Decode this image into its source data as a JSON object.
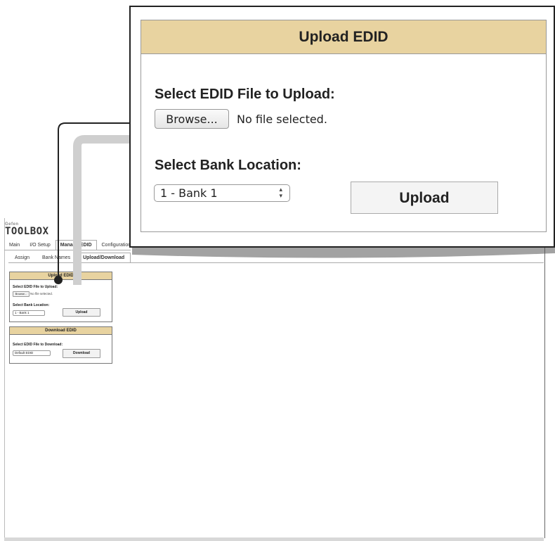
{
  "app": {
    "logo_small": "Gefen",
    "logo_big": "TOOLBOX"
  },
  "main_tabs": [
    {
      "label": "Main"
    },
    {
      "label": "I/O Setup"
    },
    {
      "label": "Manage EDID"
    },
    {
      "label": "Configuration"
    }
  ],
  "sub_tabs": [
    {
      "label": "Assign"
    },
    {
      "label": "Bank Names"
    },
    {
      "label": "Upload/Download"
    }
  ],
  "upload_panel": {
    "title": "Upload EDID",
    "file_label": "Select EDID File to Upload:",
    "browse_label": "Browse...",
    "file_status": "No file selected.",
    "bank_label": "Select Bank Location:",
    "bank_value": "1 - Bank 1",
    "upload_label": "Upload"
  },
  "download_panel": {
    "title": "Download EDID",
    "file_label": "Select EDID File to Download:",
    "file_value": "Default EDID",
    "download_label": "Download"
  },
  "colors": {
    "panel_header": "#e8d3a0"
  }
}
